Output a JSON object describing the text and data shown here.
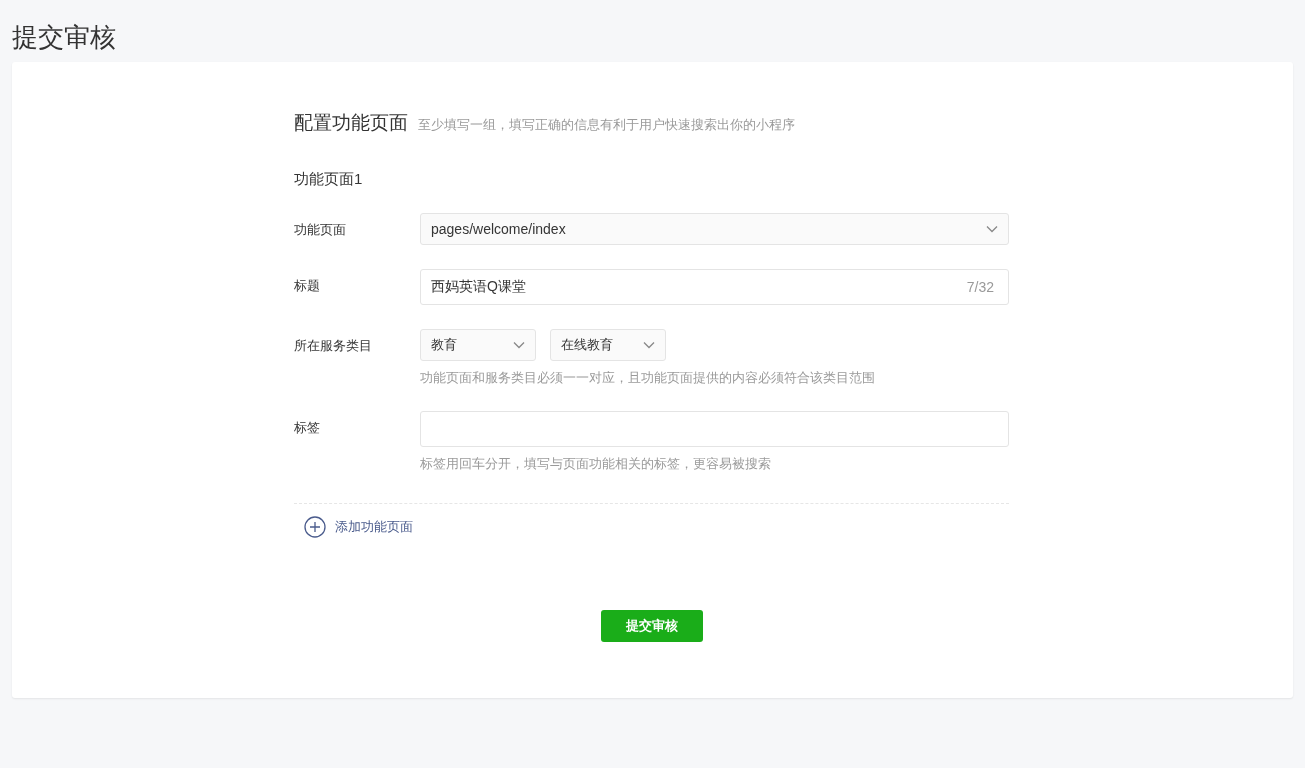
{
  "page_title": "提交审核",
  "section": {
    "title": "配置功能页面",
    "hint": "至少填写一组，填写正确的信息有利于用户快速搜索出你的小程序"
  },
  "group_title": "功能页面1",
  "fields": [
    {
      "kind": "select",
      "label": "功能页面",
      "value": "pages/welcome/index"
    },
    {
      "kind": "text",
      "label": "标题",
      "value": "西妈英语Q课堂",
      "counter": "7/32"
    },
    {
      "kind": "selects",
      "label": "所在服务类目",
      "options": [
        "教育",
        "在线教育"
      ],
      "help": "功能页面和服务类目必须一一对应，且功能页面提供的内容必须符合该类目范围"
    },
    {
      "kind": "text",
      "label": "标签",
      "help": "标签用回车分开，填写与页面功能相关的标签，更容易被搜索"
    }
  ],
  "add_link": "添加功能页面",
  "submit_button": "提交审核"
}
